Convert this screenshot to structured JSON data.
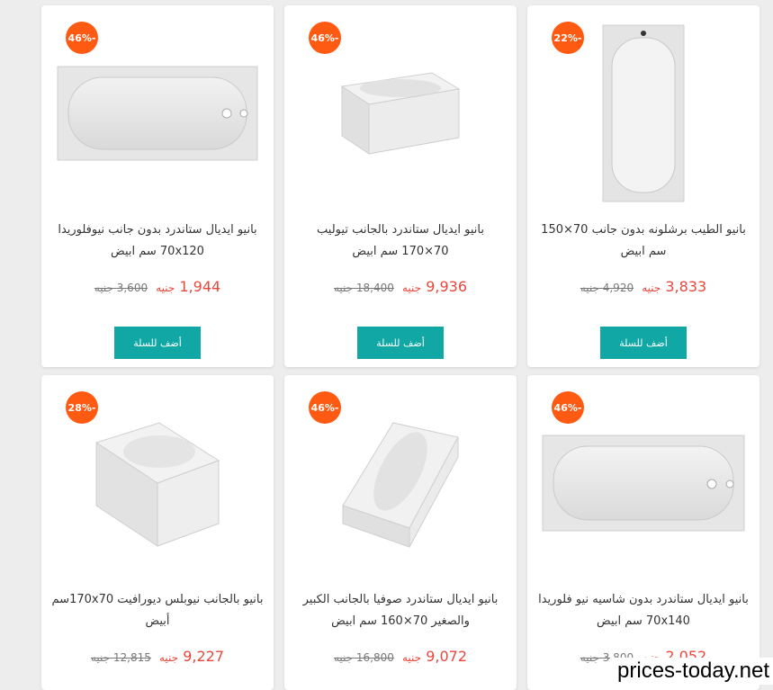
{
  "watermark": "prices-today.net",
  "products": [
    {
      "badge": "46%-",
      "title": "بانيو ايديال ستاندرد بدون جانب نيوفلوريدا 70x120 سم ابيض",
      "price": "1,944",
      "currency": "جنيه",
      "old_price": "3,600",
      "old_currency": "جنيه",
      "button": "أضف للسلة"
    },
    {
      "badge": "46%-",
      "title": "بانيو ايديال ستاندرد بالجانب تيوليب 70×170 سم ابيض",
      "price": "9,936",
      "currency": "جنيه",
      "old_price": "18,400",
      "old_currency": "جنيه",
      "button": "أضف للسلة"
    },
    {
      "badge": "22%-",
      "title": "بانيو الطيب برشلونه بدون جانب 70×150 سم ابيض",
      "price": "3,833",
      "currency": "جنيه",
      "old_price": "4,920",
      "old_currency": "جنيه",
      "button": "أضف للسلة"
    },
    {
      "badge": "28%-",
      "title": "بانيو بالجانب نيوبلس ديورافيت 170x70سم أبيض",
      "price": "9,227",
      "currency": "جنيه",
      "old_price": "12,815",
      "old_currency": "جنيه"
    },
    {
      "badge": "46%-",
      "title": "بانيو ايديال ستاندرد صوفيا بالجانب الكبير والصغير 70×160 سم ابيض",
      "price": "9,072",
      "currency": "جنيه",
      "old_price": "16,800",
      "old_currency": "جنيه"
    },
    {
      "badge": "46%-",
      "title": "بانيو ايديال ستاندرد بدون شاسيه نيو فلوريدا 70x140 سم ابيض",
      "price": "2,052",
      "currency": "جنيه",
      "old_price": "3,800",
      "old_currency": "جنيه"
    }
  ]
}
